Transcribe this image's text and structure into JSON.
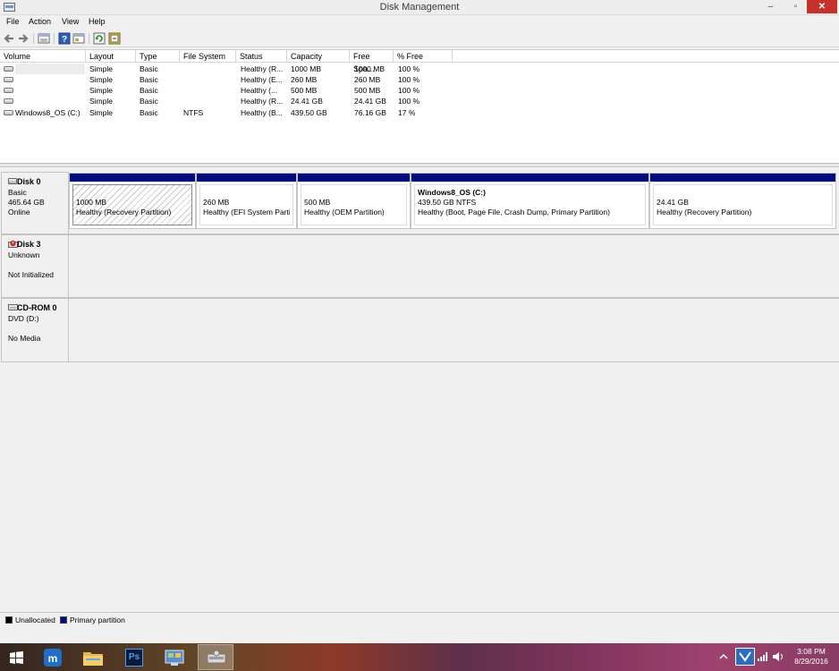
{
  "window": {
    "title": "Disk Management",
    "min_label": "–",
    "max_label": "▫",
    "close_label": "✕"
  },
  "menu": [
    "File",
    "Action",
    "View",
    "Help"
  ],
  "toolbar": {
    "icons": [
      "back-icon",
      "forward-icon",
      "volume-list-icon",
      "help-icon",
      "properties-icon",
      "refresh-icon",
      "rescan-icon"
    ]
  },
  "columns": [
    "Volume",
    "Layout",
    "Type",
    "File System",
    "Status",
    "Capacity",
    "Free Spa...",
    "% Free"
  ],
  "volumes": [
    {
      "volume": "",
      "layout": "Simple",
      "type": "Basic",
      "fs": "",
      "status": "Healthy (R...",
      "capacity": "1000 MB",
      "free": "1000 MB",
      "pct": "100 %"
    },
    {
      "volume": "",
      "layout": "Simple",
      "type": "Basic",
      "fs": "",
      "status": "Healthy (E...",
      "capacity": "260 MB",
      "free": "260 MB",
      "pct": "100 %"
    },
    {
      "volume": "",
      "layout": "Simple",
      "type": "Basic",
      "fs": "",
      "status": "Healthy (...",
      "capacity": "500 MB",
      "free": "500 MB",
      "pct": "100 %"
    },
    {
      "volume": "",
      "layout": "Simple",
      "type": "Basic",
      "fs": "",
      "status": "Healthy (R...",
      "capacity": "24.41 GB",
      "free": "24.41 GB",
      "pct": "100 %"
    },
    {
      "volume": "Windows8_OS (C:)",
      "layout": "Simple",
      "type": "Basic",
      "fs": "NTFS",
      "status": "Healthy (B...",
      "capacity": "439.50 GB",
      "free": "76.16 GB",
      "pct": "17 %"
    }
  ],
  "disks": [
    {
      "name": "Disk 0",
      "lines": [
        "Basic",
        "465.64 GB",
        "Online"
      ],
      "partitions": [
        {
          "title": "",
          "size": "1000 MB",
          "status": "Healthy (Recovery Partition)",
          "selected": true
        },
        {
          "title": "",
          "size": "260 MB",
          "status": "Healthy (EFI System Partiti"
        },
        {
          "title": "",
          "size": "500 MB",
          "status": "Healthy (OEM Partition)"
        },
        {
          "title": "Windows8_OS  (C:)",
          "size": "439.50 GB NTFS",
          "status": "Healthy (Boot, Page File, Crash Dump, Primary Partition)"
        },
        {
          "title": "",
          "size": "24.41 GB",
          "status": "Healthy (Recovery Partition)"
        }
      ]
    },
    {
      "name": "Disk 3",
      "lines": [
        "Unknown",
        "",
        "Not Initialized"
      ]
    },
    {
      "name": "CD-ROM 0",
      "lines": [
        "DVD (D:)",
        "",
        "No Media"
      ]
    }
  ],
  "legend": [
    {
      "label": "Unallocated",
      "color": "#000000"
    },
    {
      "label": "Primary partition",
      "color": "#000a80"
    }
  ],
  "taskbar": {
    "apps": [
      "start-button",
      "maxthon-icon",
      "file-explorer-icon",
      "photoshop-icon",
      "control-panel-icon",
      "disk-management-icon"
    ],
    "ps_label": "Ps",
    "time": "3:08 PM",
    "date": "8/29/2016"
  },
  "colors": {
    "primary": "#000a80",
    "close": "#c7312b"
  }
}
